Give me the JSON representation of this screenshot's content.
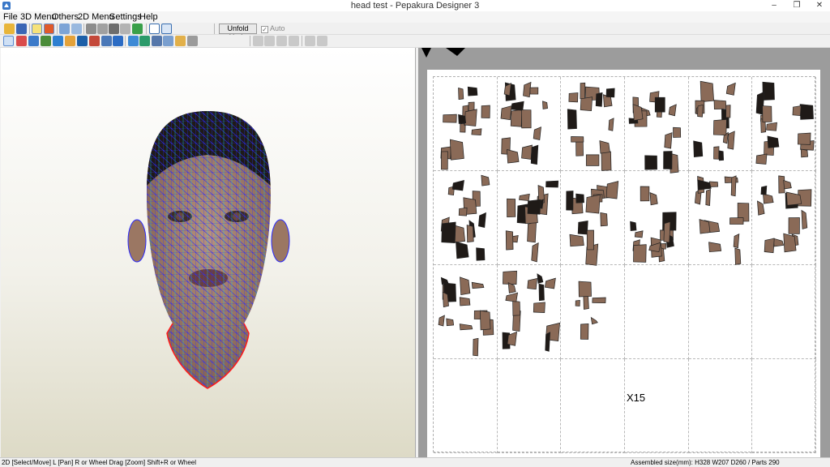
{
  "window": {
    "title": "head test - Pepakura Designer 3",
    "controls": [
      "–",
      "❐",
      "✕"
    ]
  },
  "menu": {
    "items": [
      "File",
      "3D Menu",
      "Others",
      "2D Menu",
      "Settings",
      "Help"
    ]
  },
  "toolbar": {
    "unfold_undo_label": "Unfold Undo",
    "auto_label": "Auto",
    "auto_checked": true
  },
  "sheet": {
    "multiplier_label": "X15"
  },
  "status": {
    "hint": "2D [Select/Move] L [Pan] R or Wheel Drag [Zoom] Shift+R or Wheel",
    "assembled": "Assembled size(mm): H328 W207 D260 / Parts 290"
  },
  "colors": {
    "mesh_wire": "#2a2aff",
    "mesh_wire_secondary": "#1ad4d4",
    "cut_line": "#ff1a1a",
    "skin": "#9b7763",
    "hair": "#1f1a17",
    "part_fill": "#8a6a57",
    "viewport_background_top": "#ffffff",
    "viewport_background_bottom": "#dddac6",
    "paper_area_background": "#9c9c9c"
  },
  "icons": {
    "app": "pepakura-icon",
    "toolbar_row1": [
      "open-icon",
      "save-icon",
      "light-icon",
      "texture-icon",
      "unfold-icon",
      "edit-icon",
      "paint-icon",
      "cube-icon",
      "anchor-icon",
      "print-icon",
      "flap-icon",
      "window-icon",
      "window2-icon"
    ],
    "toolbar_row2": [
      "select-icon",
      "cut-icon",
      "part-icon",
      "fold-icon",
      "join-icon",
      "texture2-icon",
      "face-icon",
      "flap-edit-icon",
      "edge-icon",
      "undo-icon",
      "redo-icon",
      "arrange-icon",
      "align-icon",
      "text-icon",
      "image-icon",
      "page-icon",
      "print2-icon"
    ],
    "toolbar_align": [
      "align-left-icon",
      "align-center-icon",
      "align-top-icon",
      "align-bottom-icon",
      "rotate-left-icon",
      "rotate-right-icon"
    ]
  }
}
